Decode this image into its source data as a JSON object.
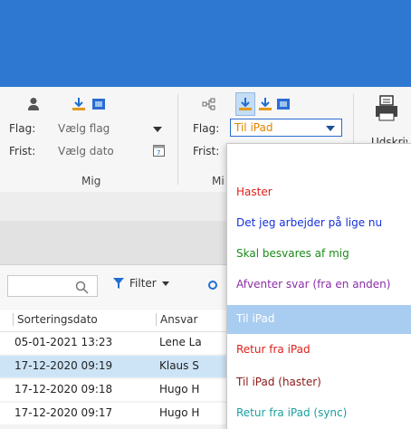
{
  "ribbon": {
    "mig": {
      "flag_label": "Flag:",
      "flag_value": "Vælg flag",
      "frist_label": "Frist:",
      "frist_value": "Vælg dato",
      "group_label": "Mig"
    },
    "second": {
      "flag_label": "Flag:",
      "flag_value": "Til iPad",
      "frist_label": "Frist:",
      "group_label": "Mi"
    },
    "print_label": "Udskriv"
  },
  "toolbar": {
    "filter_label": "Filter"
  },
  "table": {
    "columns": [
      "Sorteringsdato",
      "Ansvar"
    ],
    "rows": [
      {
        "date": "05-01-2021 13:23",
        "owner": "Lene La"
      },
      {
        "date": "17-12-2020 09:19",
        "owner": "Klaus S",
        "selected": true
      },
      {
        "date": "17-12-2020 09:18",
        "owner": "Hugo H"
      },
      {
        "date": "17-12-2020 09:17",
        "owner": "Hugo H"
      }
    ]
  },
  "flag_menu": {
    "items": [
      {
        "label": "Haster",
        "color": "#e0201b"
      },
      {
        "label": "Det jeg arbejder på lige nu",
        "color": "#1530d8"
      },
      {
        "label": "Skal besvares af mig",
        "color": "#1b8a1b"
      },
      {
        "label": "Afventer svar (fra en anden)",
        "color": "#8a2ea6"
      },
      {
        "label": "Til iPad",
        "color": "#ffffff",
        "highlighted": true
      },
      {
        "label": "Retur fra iPad",
        "color": "#e0201b"
      },
      {
        "label": "Til iPad (haster)",
        "color": "#8a1818"
      },
      {
        "label": "Retur fra iPad (sync)",
        "color": "#1b9f9f"
      }
    ]
  },
  "icons": [
    "person-icon",
    "download-icon",
    "sync-icon",
    "flow-icon",
    "calendar-icon",
    "dropdown-arrow-icon",
    "printer-icon",
    "search-icon",
    "filter-icon"
  ]
}
